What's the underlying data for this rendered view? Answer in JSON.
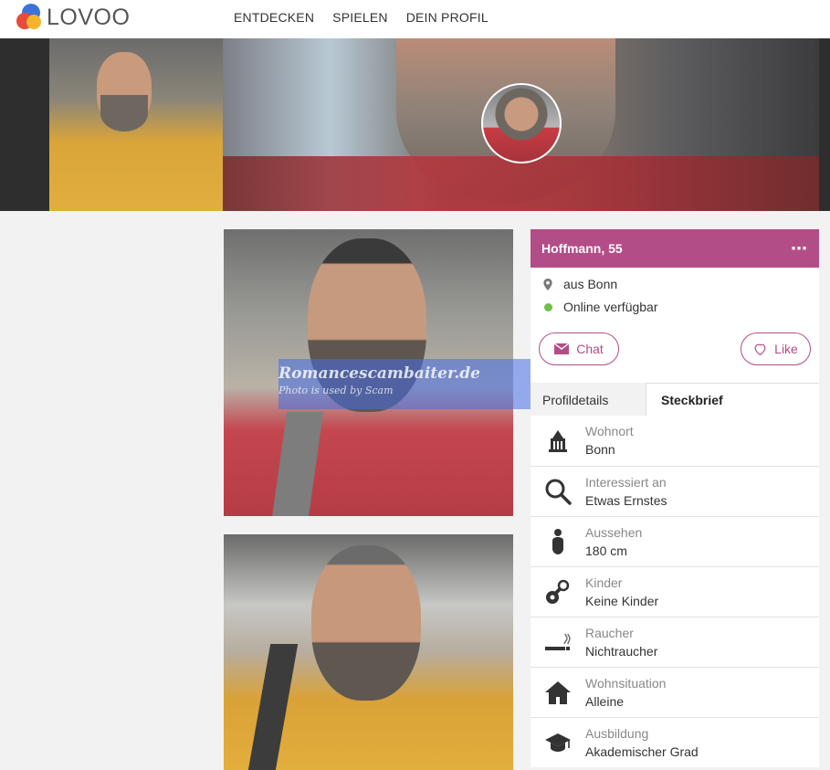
{
  "brand": {
    "name": "LOVOO"
  },
  "nav": {
    "items": [
      "ENTDECKEN",
      "SPIELEN",
      "DEIN PROFIL"
    ]
  },
  "watermark": {
    "line1": "Romancescambaiter.de",
    "line2": "Photo is used by Scam"
  },
  "profile": {
    "name_age": "Hoffmann, 55",
    "more_icon": "more-dots-icon",
    "location": "aus Bonn",
    "status": "Online verfügbar",
    "chat_label": "Chat",
    "like_label": "Like",
    "accent_color": "#b34d87",
    "online_color": "#6cc04a"
  },
  "tabs": {
    "profile_details": "Profildetails",
    "fact_sheet": "Steckbrief"
  },
  "facts": [
    {
      "icon": "landmark-icon",
      "label": "Wohnort",
      "value": "Bonn"
    },
    {
      "icon": "search-icon",
      "label": "Interessiert an",
      "value": "Etwas Ernstes"
    },
    {
      "icon": "person-icon",
      "label": "Aussehen",
      "value": "180 cm"
    },
    {
      "icon": "pacifier-icon",
      "label": "Kinder",
      "value": "Keine Kinder"
    },
    {
      "icon": "cigarette-icon",
      "label": "Raucher",
      "value": "Nichtraucher"
    },
    {
      "icon": "house-icon",
      "label": "Wohnsituation",
      "value": "Alleine"
    },
    {
      "icon": "graduation-cap-icon",
      "label": "Ausbildung",
      "value": "Akademischer Grad"
    }
  ]
}
